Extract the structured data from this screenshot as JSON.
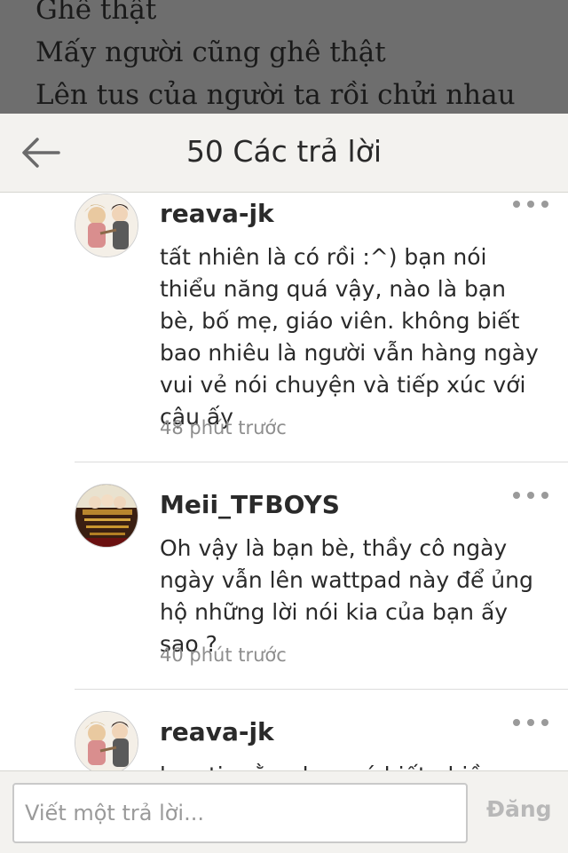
{
  "story": {
    "lines": [
      "Ghê thật",
      "Mấy người cũng ghê thật",
      "Lên tus của người ta rồi chửi nhau"
    ]
  },
  "header": {
    "back_icon": "arrow-left-icon",
    "title": "50 Các trả lời"
  },
  "comments": [
    {
      "username": "reava-jk",
      "text": "tất nhiên là có rồi :^) bạn nói thiểu năng quá vậy, nào là bạn bè, bố mẹ, giáo viên. không biết bao nhiêu là người vẫn hàng ngày vui vẻ nói chuyện và tiếp xúc với cậu ấy",
      "time": "48 phút trước",
      "more_icon": "more-dots-icon"
    },
    {
      "username": "Meii_TFBOYS",
      "text": "Oh vậy là bạn bè, thầy cô ngày ngày vẫn lên wattpad này để ủng hộ những lời nói kia của bạn ấy sao ?",
      "time": "40 phút trước",
      "more_icon": "more-dots-icon"
    },
    {
      "username": "reava-jk",
      "text": "bạn tin rằng bạn có biết nhiều",
      "time": "",
      "more_icon": "more-dots-icon"
    }
  ],
  "footer": {
    "placeholder": "Viết một trả lời...",
    "post_label": "Đăng"
  },
  "colors": {
    "overlay": "#6e6e6e",
    "header_bg": "#f3f2ef",
    "text": "#2a2a2a",
    "muted": "#8e8e8e",
    "disabled": "#b8b8b8"
  }
}
